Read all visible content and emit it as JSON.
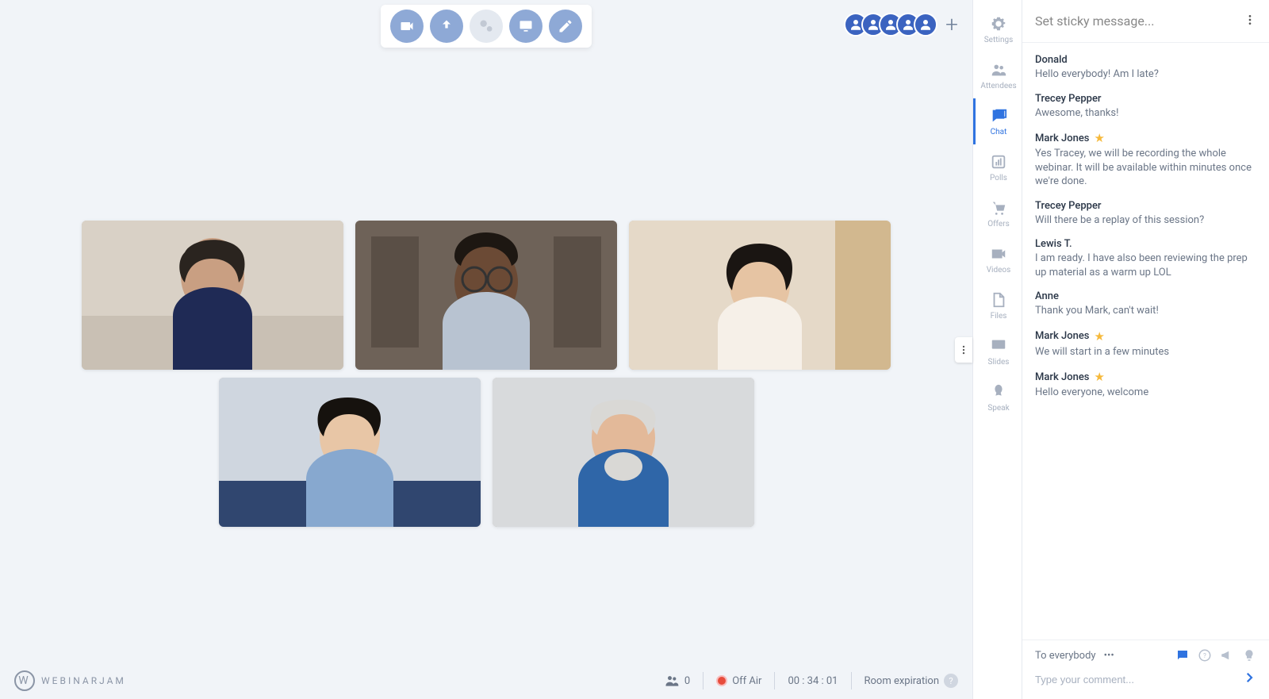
{
  "toolbar": {
    "camera": "camera",
    "mic": "mic",
    "share": "share",
    "screen": "screen",
    "draw": "draw"
  },
  "participants_bubbles": 5,
  "sidebar": {
    "items": [
      {
        "id": "settings",
        "label": "Settings"
      },
      {
        "id": "attendees",
        "label": "Attendees"
      },
      {
        "id": "chat",
        "label": "Chat"
      },
      {
        "id": "polls",
        "label": "Polls"
      },
      {
        "id": "offers",
        "label": "Offers"
      },
      {
        "id": "videos",
        "label": "Videos"
      },
      {
        "id": "files",
        "label": "Files"
      },
      {
        "id": "slides",
        "label": "Slides"
      },
      {
        "id": "speak",
        "label": "Speak"
      }
    ],
    "active": "chat"
  },
  "chat": {
    "sticky_placeholder": "Set sticky message...",
    "messages": [
      {
        "name": "Donald",
        "starred": false,
        "text": "Hello everybody! Am I late?"
      },
      {
        "name": "Trecey Pepper",
        "starred": false,
        "text": "Awesome, thanks!"
      },
      {
        "name": "Mark Jones",
        "starred": true,
        "text": "Yes Tracey, we will be recording the whole webinar. It will be available within minutes once we're done."
      },
      {
        "name": "Trecey Pepper",
        "starred": false,
        "text": "Will there be a replay of this session?"
      },
      {
        "name": "Lewis T.",
        "starred": false,
        "text": "I am ready. I have also been reviewing the prep up material as a warm up LOL"
      },
      {
        "name": "Anne",
        "starred": false,
        "text": "Thank you Mark, can't wait!"
      },
      {
        "name": "Mark Jones",
        "starred": true,
        "text": "We will start in a few minutes"
      },
      {
        "name": "Mark Jones",
        "starred": true,
        "text": "Hello everyone, welcome"
      }
    ],
    "audience_label": "To everybody",
    "input_placeholder": "Type your comment..."
  },
  "footer": {
    "brand": "WEBINARJAM",
    "attendee_count": "0",
    "air_status": "Off Air",
    "timer": "00 : 34 : 01",
    "expiration_label": "Room expiration"
  }
}
